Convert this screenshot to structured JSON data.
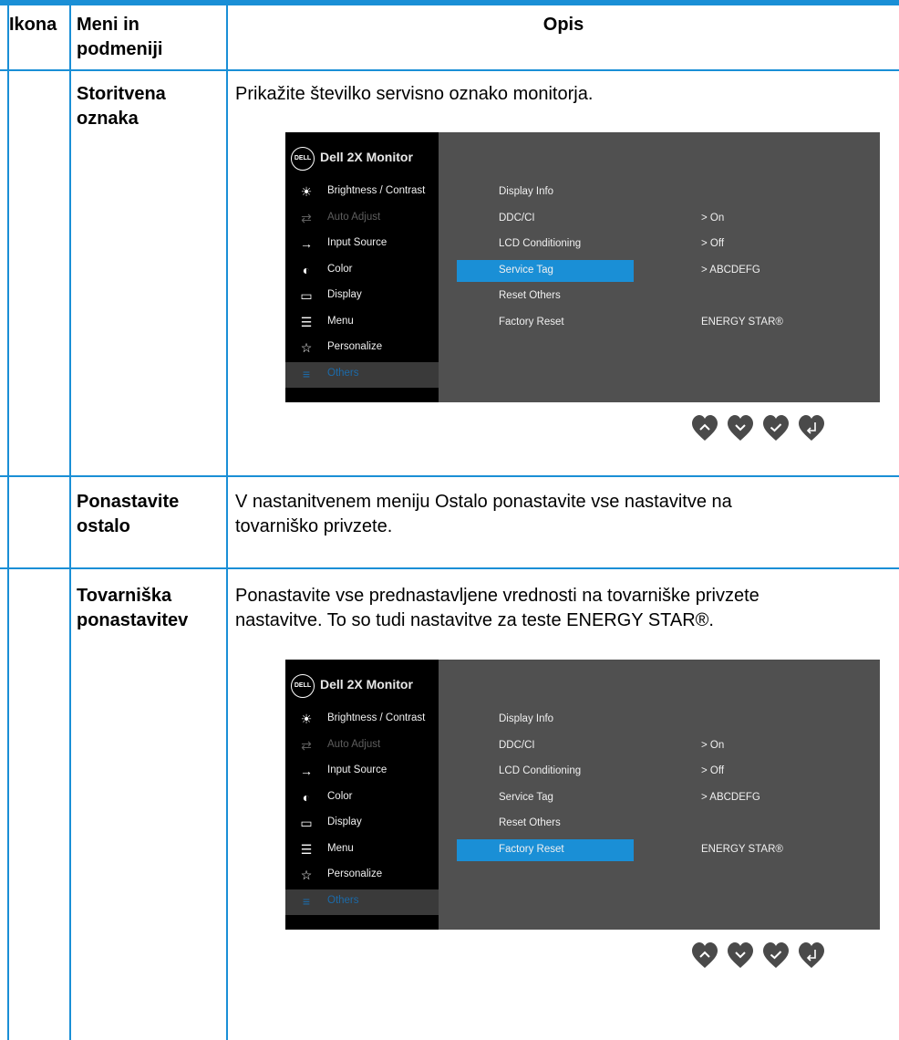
{
  "table": {
    "headers": {
      "icon": "Ikona",
      "menu_line1": "Meni in",
      "menu_line2": "podmeniji",
      "desc": "Opis"
    },
    "rows": [
      {
        "name_line1": "Storitvena",
        "name_line2": "oznaka",
        "desc_line1": "Prikažite številko servisno oznako monitorja.",
        "desc_line2": ""
      },
      {
        "name_line1": "Ponastavite",
        "name_line2": "ostalo",
        "desc_line1": "V nastanitvenem meniju Ostalo ponastavite vse nastavitve na",
        "desc_line2": "tovarniško privzete."
      },
      {
        "name_line1": "Tovarniška",
        "name_line2": "ponastavitev",
        "desc_line1": "Ponastavite vse prednastavljene vrednosti na tovarniške privzete",
        "desc_line2": "nastavitve. To so tudi nastavitve za teste ENERGY STAR®."
      }
    ]
  },
  "osd": {
    "logo": "DELL",
    "title": "Dell 2X Monitor",
    "menu": [
      {
        "label": "Brightness / Contrast",
        "icon": "brightness-icon"
      },
      {
        "label": "Auto Adjust",
        "icon": "auto-adjust-icon"
      },
      {
        "label": "Input Source",
        "icon": "input-source-icon"
      },
      {
        "label": "Color",
        "icon": "color-icon"
      },
      {
        "label": "Display",
        "icon": "display-icon"
      },
      {
        "label": "Menu",
        "icon": "menu-icon"
      },
      {
        "label": "Personalize",
        "icon": "star-icon"
      },
      {
        "label": "Others",
        "icon": "others-icon"
      }
    ],
    "submenu": [
      "Display Info",
      "DDC/CI",
      "LCD Conditioning",
      "Service Tag",
      "Reset Others",
      "Factory Reset"
    ],
    "values": {
      "ddcci": ">   On",
      "lcd": ">   Off",
      "service_tag": ">   ABCDEFG",
      "energy": "ENERGY STAR®"
    },
    "highlight_color": "#1a8fd6",
    "osd1_highlight": "Service Tag",
    "osd2_highlight": "Factory Reset"
  },
  "nav_buttons": [
    "up-icon",
    "down-icon",
    "check-icon",
    "back-icon"
  ]
}
